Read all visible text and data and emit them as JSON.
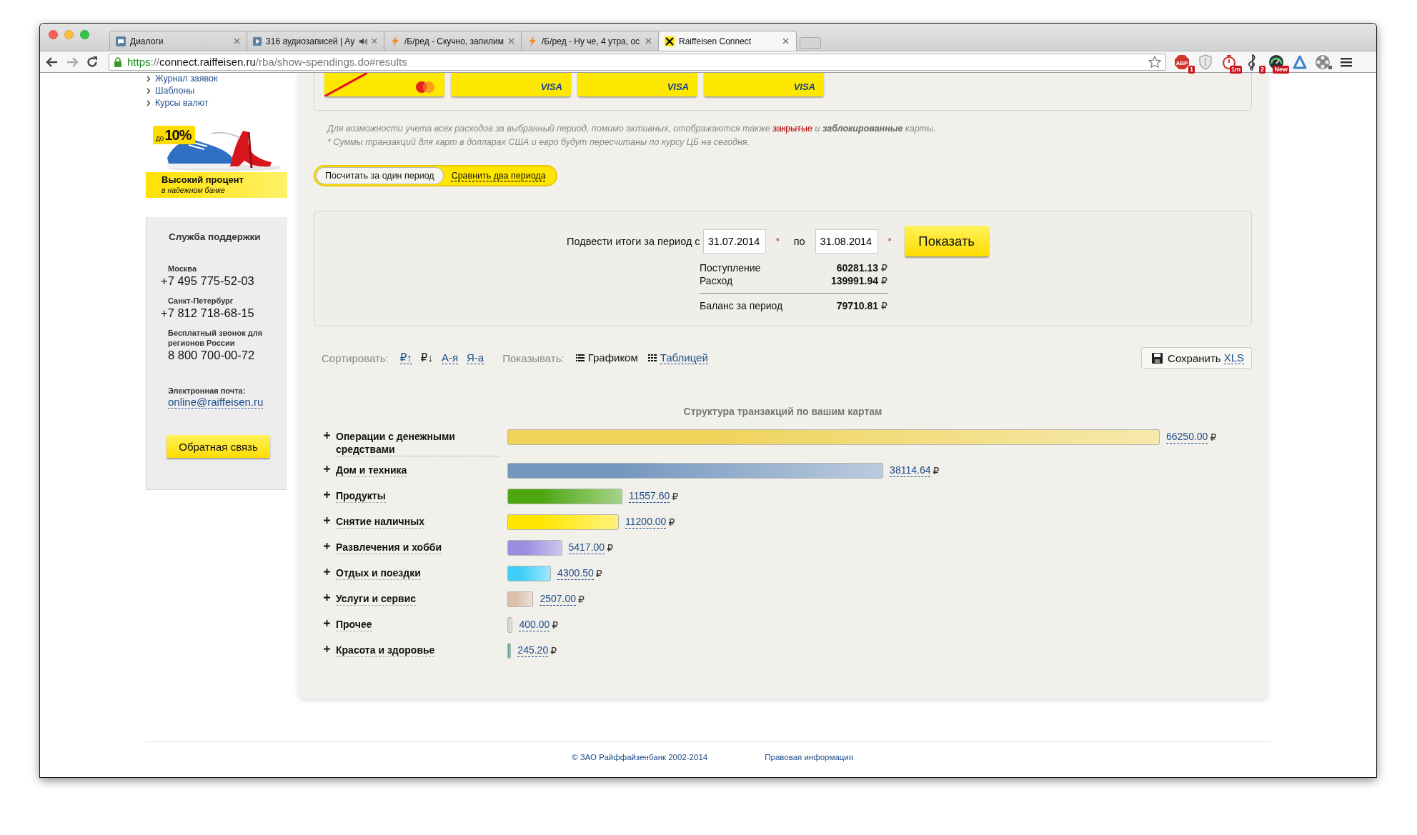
{
  "browser": {
    "tabs": [
      {
        "title": "Диалоги",
        "kind": "chat",
        "audio": false,
        "selected": false
      },
      {
        "title": "316 аудиозаписей | Ау",
        "kind": "play",
        "audio": true,
        "selected": false
      },
      {
        "title": "/Б/ред - Скучно, запилим",
        "kind": "bolt",
        "audio": false,
        "selected": false
      },
      {
        "title": "/Б/ред - Ну че, 4 утра, ос",
        "kind": "bolt",
        "audio": false,
        "selected": false
      },
      {
        "title": "Raiffeisen Connect",
        "kind": "raiffeisen",
        "audio": false,
        "selected": true
      }
    ],
    "url": {
      "scheme": "https",
      "separator": "://",
      "host": "connect.raiffeisen.ru",
      "path": "/rba/show-spendings.do#results"
    },
    "extensions": [
      {
        "kind": "abp",
        "label": "ABP",
        "badge": "1"
      },
      {
        "kind": "shield"
      },
      {
        "kind": "timer",
        "badge": "1m"
      },
      {
        "kind": "music",
        "badge": "2"
      },
      {
        "kind": "gauge",
        "badge": "New"
      },
      {
        "kind": "arch"
      },
      {
        "kind": "reel"
      }
    ]
  },
  "sidebar": {
    "links": [
      "Журнал заявок",
      "Шаблоны",
      "Курсы валют"
    ],
    "promo": {
      "tag_prefix": "до",
      "tag_value": "10%",
      "title": "Высокий процент",
      "subtitle": "в надежном банке"
    },
    "support": {
      "title": "Служба поддержки",
      "contacts": [
        {
          "label": "Москва",
          "value": "+7 495 775-52-03"
        },
        {
          "label": "Санкт-Петербург",
          "value": "+7 812 718-68-15"
        },
        {
          "label": "Бесплатный звонок для регионов России",
          "value": "8 800 700-00-72"
        }
      ],
      "email_label": "Электронная почта:",
      "email": "online@raiffeisen.ru",
      "button": "Обратная связь"
    }
  },
  "cards": [
    {
      "kind": "mastercard",
      "crossed": true
    },
    {
      "kind": "visa",
      "brand": "VISA",
      "crossed": false
    },
    {
      "kind": "visa",
      "brand": "VISA",
      "crossed": false
    },
    {
      "kind": "visa",
      "brand": "VISA",
      "crossed": false
    }
  ],
  "notes": {
    "first_before": "Для возможности учета всех расходов за выбранный период, помимо активных, отображаются также ",
    "first_struck": "закрытые",
    "first_after": " и **заблокированные** карты.",
    "second": "* Суммы транзакций для карт в долларах США и евро будут пересчитаны по курсу ЦБ на сегодня."
  },
  "modes": [
    {
      "label": "Посчитать за один период",
      "selected": true
    },
    {
      "label": "Сравнить два периода",
      "selected": false
    }
  ],
  "period": {
    "label": "Подвести итоги за период с",
    "from": "31.07.2014",
    "from_mark": "*",
    "to_label": "по",
    "to": "31.08.2014",
    "to_mark": "*",
    "button": "Показать",
    "summary": [
      {
        "label": "Поступление",
        "value": "60281.13",
        "currency": "₽"
      },
      {
        "label": "Расход",
        "value": "139991.94",
        "currency": "₽"
      }
    ],
    "balance": {
      "label": "Баланс за период",
      "value": "79710.81",
      "currency": "₽"
    }
  },
  "toolbar": {
    "sort_label": "Сортировать:",
    "sort": [
      {
        "label": "₽↑",
        "selected": false
      },
      {
        "label": "₽↓",
        "selected": true
      },
      {
        "label": "А-я",
        "selected": false
      },
      {
        "label": "Я-а",
        "selected": false
      }
    ],
    "view_label": "Показывать:",
    "views": [
      {
        "label": "Графиком",
        "kind": "list",
        "selected": true
      },
      {
        "label": "Таблицей",
        "kind": "grid",
        "selected": false
      }
    ],
    "save": {
      "label": "Сохранить",
      "link": "XLS"
    }
  },
  "chart": {
    "title": "Структура транзакций по вашим картам",
    "categories": [
      {
        "label": "Операции с денежными средствами",
        "amount": "66250.00",
        "currency": "₽",
        "level": 1,
        "color": "#efd35a"
      },
      {
        "label": "Дом и техника",
        "amount": "38114.64",
        "currency": "₽",
        "level": 0.5753,
        "color": "#7597be"
      },
      {
        "label": "Продукты",
        "amount": "11557.60",
        "currency": "₽",
        "level": 0.1745,
        "color": "#4ea711"
      },
      {
        "label": "Снятие наличных",
        "amount": "11200.00",
        "currency": "₽",
        "level": 0.1691,
        "color": "#ffe500"
      },
      {
        "label": "Развлечения и хобби",
        "amount": "5417.00",
        "currency": "₽",
        "level": 0.0818,
        "color": "#9b8ce0"
      },
      {
        "label": "Отдых и поездки",
        "amount": "4300.50",
        "currency": "₽",
        "level": 0.0649,
        "color": "#3ecef7"
      },
      {
        "label": "Услуги и сервис",
        "amount": "2507.00",
        "currency": "₽",
        "level": 0.0378,
        "color": "#dcbfa9"
      },
      {
        "label": "Прочее",
        "amount": "400.00",
        "currency": "₽",
        "level": 0.006,
        "color": "#d4d4d4"
      },
      {
        "label": "Красота и здоровье",
        "amount": "245.20",
        "currency": "₽",
        "level": 0.0037,
        "color": "#55a89a"
      }
    ]
  },
  "footer": {
    "copyright": "© ЗАО Райффайзенбанк 2002-2014",
    "legal": "Правовая информация"
  }
}
